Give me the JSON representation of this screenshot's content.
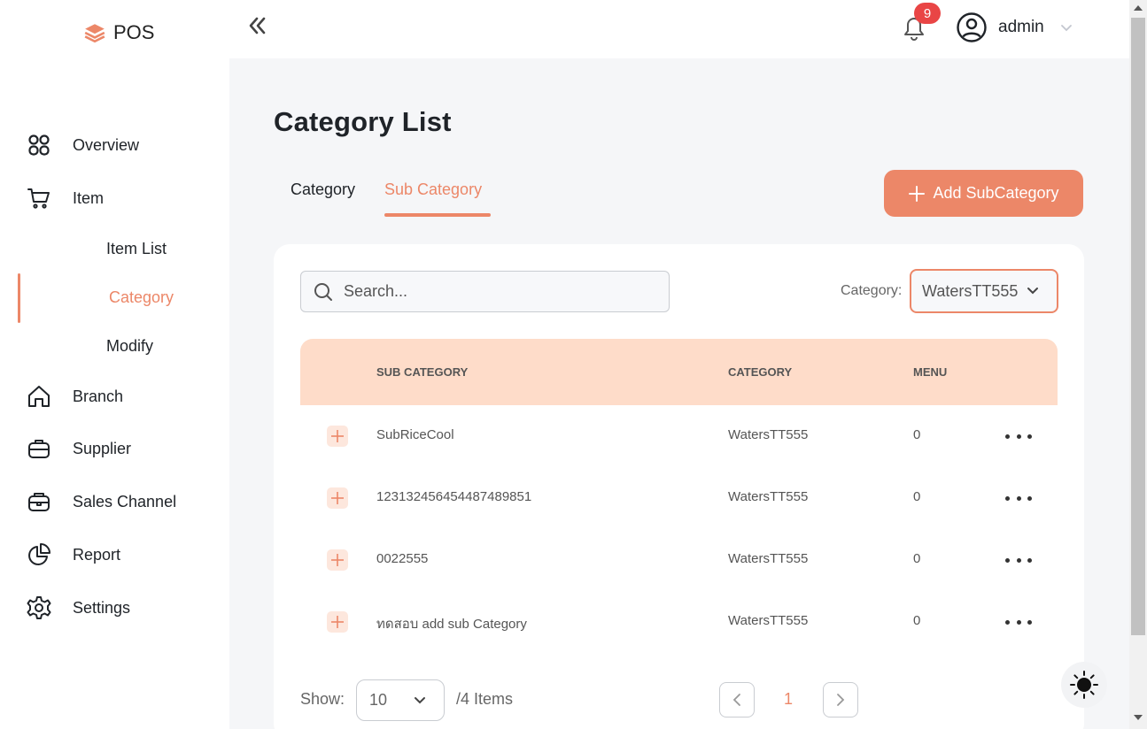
{
  "app": {
    "logo_text": "POS"
  },
  "sidebar": {
    "items": [
      {
        "label": "Overview",
        "icon": "grid-icon"
      },
      {
        "label": "Item",
        "icon": "cart-icon"
      },
      {
        "label": "Branch",
        "icon": "home-icon"
      },
      {
        "label": "Supplier",
        "icon": "briefcase-icon"
      },
      {
        "label": "Sales Channel",
        "icon": "database-icon"
      },
      {
        "label": "Report",
        "icon": "pie-chart-icon"
      },
      {
        "label": "Settings",
        "icon": "gear-icon"
      }
    ],
    "sub_items": [
      {
        "label": "Item List"
      },
      {
        "label": "Category",
        "active": true
      },
      {
        "label": "Modify"
      }
    ]
  },
  "topbar": {
    "notification_count": "9",
    "user_name": "admin"
  },
  "page": {
    "title": "Category List",
    "tabs": [
      {
        "label": "Category"
      },
      {
        "label": "Sub Category",
        "active": true
      }
    ],
    "add_button_label": "Add SubCategory"
  },
  "filters": {
    "search_placeholder": "Search...",
    "category_label": "Category:",
    "category_value": "WatersTT555"
  },
  "table": {
    "columns": [
      "SUB CATEGORY",
      "CATEGORY",
      "MENU"
    ],
    "rows": [
      {
        "sub_category": "SubRiceCool",
        "category": "WatersTT555",
        "menu": "0"
      },
      {
        "sub_category": "12313245645448748985​1",
        "category": "WatersTT555",
        "menu": "0"
      },
      {
        "sub_category": "0022555",
        "category": "WatersTT555",
        "menu": "0"
      },
      {
        "sub_category": "ทดสอบ add sub Category",
        "category": "WatersTT555",
        "menu": "0"
      }
    ]
  },
  "pagination": {
    "show_label": "Show:",
    "page_size": "10",
    "items_count": "/4 Items",
    "current_page": "1"
  },
  "colors": {
    "accent": "#ec8768",
    "table_header": "#fedcc9",
    "badge": "#e94545"
  }
}
